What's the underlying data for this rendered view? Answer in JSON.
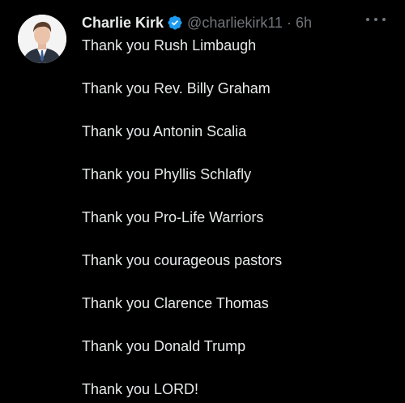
{
  "tweet": {
    "author": {
      "display_name": "Charlie Kirk",
      "handle": "@charliekirk11",
      "verified_icon": "verified-badge-icon",
      "avatar": "profile-photo"
    },
    "separator": "·",
    "time": "6h",
    "more_icon": "more-options-icon",
    "lines": [
      "Thank you Rush Limbaugh",
      "Thank you Rev. Billy Graham",
      "Thank you Antonin Scalia",
      "Thank you Phyllis Schlafly",
      "Thank you Pro-Life Warriors",
      "Thank you courageous pastors",
      "Thank you Clarence Thomas",
      "Thank you Donald Trump",
      "Thank you LORD!"
    ]
  },
  "colors": {
    "background": "#000000",
    "text_primary": "#e7e9ea",
    "text_secondary": "#71767b",
    "verified_blue": "#1d9bf0"
  }
}
